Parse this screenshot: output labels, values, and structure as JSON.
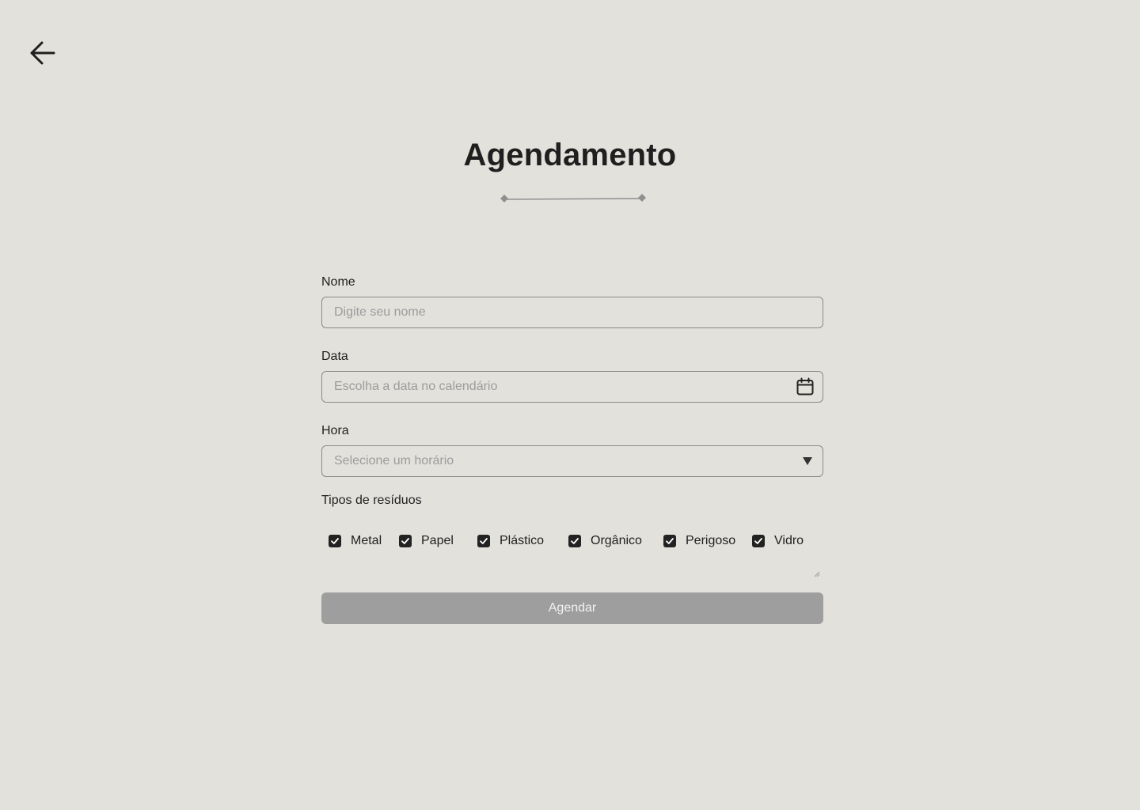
{
  "page": {
    "title": "Agendamento"
  },
  "header": {
    "back_icon": "arrow-left-icon"
  },
  "form": {
    "name": {
      "label": "Nome",
      "placeholder": "Digite seu nome",
      "value": ""
    },
    "date": {
      "label": "Data",
      "placeholder": "Escolha a data no calendário",
      "value": "",
      "icon": "calendar-icon"
    },
    "time": {
      "label": "Hora",
      "placeholder": "Selecione um horário",
      "icon": "caret-down-icon"
    },
    "waste_types": {
      "label": "Tipos de resíduos",
      "options": [
        {
          "label": "Metal",
          "checked": true
        },
        {
          "label": "Papel",
          "checked": true
        },
        {
          "label": "Plástico",
          "checked": true
        },
        {
          "label": "Orgânico",
          "checked": true
        },
        {
          "label": "Perigoso",
          "checked": true
        },
        {
          "label": "Vidro",
          "checked": true
        }
      ]
    },
    "submit_label": "Agendar"
  },
  "colors": {
    "background": "#e3e1dc",
    "text": "#1f1f1f",
    "placeholder": "#9c9c9c",
    "border": "#8a8a8a",
    "checkbox": "#222222",
    "button_disabled": "#9e9e9e",
    "button_text": "#f2f2f2"
  }
}
